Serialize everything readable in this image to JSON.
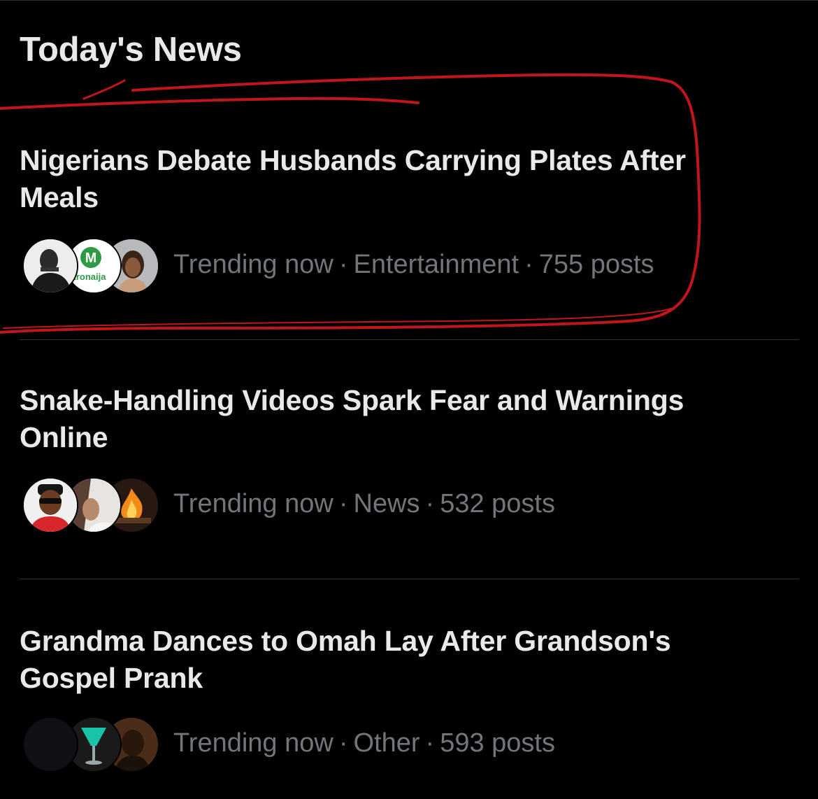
{
  "section": {
    "title": "Today's News"
  },
  "news": [
    {
      "headline": "Nigerians Debate Husbands Carrying Plates After Meals",
      "status": "Trending now",
      "category": "Entertainment",
      "posts": "755 posts",
      "avatars": [
        "avatar-person-photo",
        "avatar-metronaija-logo",
        "avatar-woman-photo"
      ],
      "avatar_logo_text": "M",
      "avatar_logo_caption": "tronaija"
    },
    {
      "headline": "Snake-Handling Videos Spark Fear and Warnings Online",
      "status": "Trending now",
      "category": "News",
      "posts": "532 posts",
      "avatars": [
        "avatar-man-sunglasses-photo",
        "avatar-woman-photo",
        "avatar-fire-photo"
      ]
    },
    {
      "headline": "Grandma Dances to Omah Lay After Grandson's Gospel Prank",
      "status": "Trending now",
      "category": "Other",
      "posts": "593 posts",
      "avatars": [
        "avatar-dark-photo",
        "avatar-drink-photo",
        "avatar-man-photo"
      ]
    }
  ],
  "colors": {
    "background": "#000000",
    "headline": "#e7e9ea",
    "meta": "#71767b",
    "divider": "#2f3336",
    "annotation": "#c0161b",
    "logo_green": "#2e9a43"
  }
}
